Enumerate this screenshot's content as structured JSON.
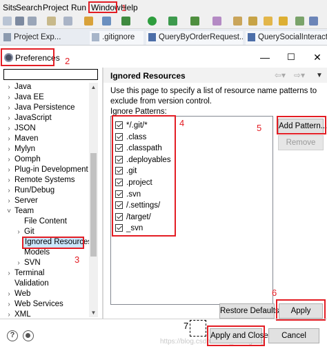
{
  "menubar": {
    "items": [
      "Sits",
      "Search",
      "Project",
      "Run",
      "Window",
      "Help"
    ]
  },
  "editor_tabs": {
    "project_explorer": "Project Exp...",
    "tabs": [
      ".gitignore",
      "QueryByOrderRequest....",
      "QuerySocialInteractio..."
    ]
  },
  "dialog": {
    "title": "Preferences",
    "minimize": "—",
    "maximize": "☐",
    "close": "✕"
  },
  "tree": {
    "items": [
      {
        "label": "Java",
        "expander": "›"
      },
      {
        "label": "Java EE",
        "expander": "›"
      },
      {
        "label": "Java Persistence",
        "expander": "›"
      },
      {
        "label": "JavaScript",
        "expander": "›"
      },
      {
        "label": "JSON",
        "expander": "›"
      },
      {
        "label": "Maven",
        "expander": "›"
      },
      {
        "label": "Mylyn",
        "expander": "›"
      },
      {
        "label": "Oomph",
        "expander": "›"
      },
      {
        "label": "Plug-in Development",
        "expander": "›"
      },
      {
        "label": "Remote Systems",
        "expander": "›"
      },
      {
        "label": "Run/Debug",
        "expander": "›"
      },
      {
        "label": "Server",
        "expander": "›"
      },
      {
        "label": "Team",
        "expander": "˅"
      },
      {
        "label": "File Content",
        "expander": ""
      },
      {
        "label": "Git",
        "expander": "›"
      },
      {
        "label": "Ignored Resources",
        "expander": ""
      },
      {
        "label": "Models",
        "expander": ""
      },
      {
        "label": "SVN",
        "expander": "›"
      },
      {
        "label": "Terminal",
        "expander": "›"
      },
      {
        "label": "Validation",
        "expander": ""
      },
      {
        "label": "Web",
        "expander": "›"
      },
      {
        "label": "Web Services",
        "expander": "›"
      },
      {
        "label": "XML",
        "expander": "›"
      }
    ]
  },
  "page": {
    "title": "Ignored Resources",
    "description": "Use this page to specify a list of resource name patterns to exclude from version control.",
    "patterns_label": "Ignore Patterns:",
    "patterns": [
      "*/.git/*",
      ".class",
      ".classpath",
      ".deployables",
      ".git",
      ".project",
      ".svn",
      "/.settings/",
      "/target/",
      "_svn"
    ],
    "add_pattern_label": "Add Pattern...",
    "remove_label": "Remove",
    "restore_defaults_label": "Restore Defaults",
    "apply_label": "Apply"
  },
  "footer": {
    "help_icon_glyph": "?",
    "apply_and_close_label": "Apply and Close",
    "cancel_label": "Cancel",
    "watermark": "https://blog.csdn.net/m_Leongong"
  },
  "annotations": [
    "1",
    "2",
    "3",
    "4",
    "5",
    "6",
    "7"
  ],
  "colors": {
    "annotation_red": "#e31c23",
    "selection_highlight": "#cce8ff",
    "button_face": "#e1e1e1"
  }
}
